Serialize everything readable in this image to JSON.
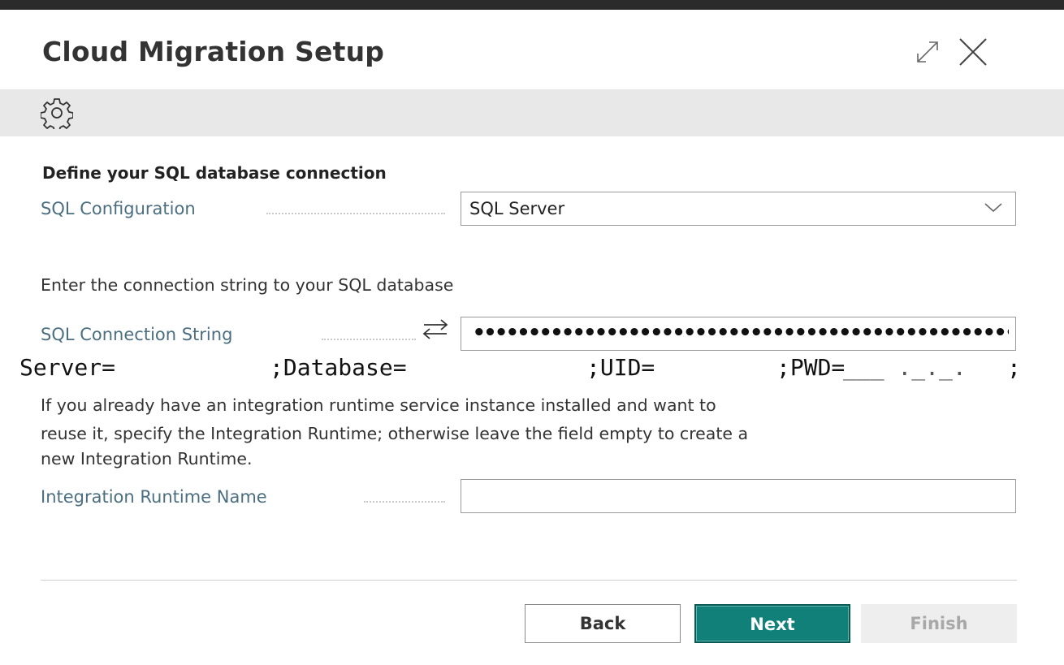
{
  "window": {
    "title": "Cloud Migration Setup",
    "expand_icon": "expand-icon",
    "close_icon": "close-icon"
  },
  "actionbar": {
    "settings_icon": "gear-icon"
  },
  "sql_section": {
    "heading": "Define your SQL database connection",
    "config_label": "SQL Configuration",
    "config_value": "SQL Server"
  },
  "connection_section": {
    "instruction": "Enter the connection string to your SQL database",
    "string_label": "SQL Connection String",
    "string_masked_value": "•••••••••••••••••••••••••••••••••••••••••••••••••••••"
  },
  "overlay": {
    "server": "Server=",
    "database": ";Database=",
    "uid": ";UID=",
    "pwd": ";PWD=",
    "pwd_value": "___ ._._.",
    "end": ";"
  },
  "runtime_section": {
    "instruction_line1": "If you already have an integration runtime service instance installed and want to",
    "instruction_line2": "reuse it, specify the Integration Runtime; otherwise leave the field empty to create a",
    "instruction_line3": "new Integration Runtime.",
    "name_label": "Integration Runtime Name",
    "name_value": ""
  },
  "footer": {
    "back_label": "Back",
    "next_label": "Next",
    "finish_label": "Finish"
  },
  "colors": {
    "accent": "#108078",
    "label": "#4b6f80",
    "actionbar_bg": "#e8e8e8"
  }
}
